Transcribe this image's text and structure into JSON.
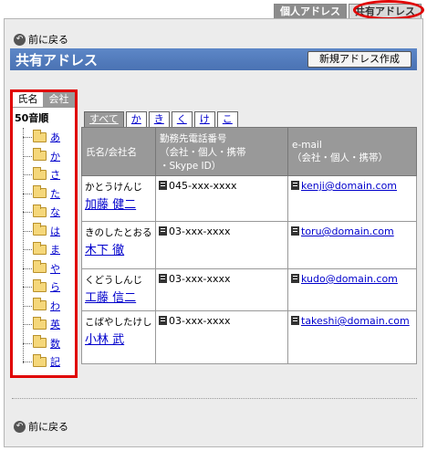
{
  "top_tabs": [
    {
      "label": "個人アドレス"
    },
    {
      "label": "共有アドレス"
    }
  ],
  "back_label": "前に戻る",
  "back_label_bottom": "前に戻る",
  "title": "共有アドレス",
  "new_button": "新規アドレス作成",
  "index": {
    "tabs": [
      {
        "label": "氏名"
      },
      {
        "label": "会社"
      }
    ],
    "heading": "50音順",
    "items": [
      {
        "label": "あ"
      },
      {
        "label": "か"
      },
      {
        "label": "さ"
      },
      {
        "label": "た"
      },
      {
        "label": "な"
      },
      {
        "label": "は"
      },
      {
        "label": "ま"
      },
      {
        "label": "や"
      },
      {
        "label": "ら"
      },
      {
        "label": "わ"
      },
      {
        "label": "英"
      },
      {
        "label": "数"
      },
      {
        "label": "記"
      }
    ]
  },
  "kana_tabs": [
    {
      "label": "すべて"
    },
    {
      "label": "か"
    },
    {
      "label": "き"
    },
    {
      "label": "く"
    },
    {
      "label": "け"
    },
    {
      "label": "こ"
    }
  ],
  "table": {
    "headers": {
      "name": "氏名/会社名",
      "phone": "勤務先電話番号\n（会社・個人・携帯\n・Skype ID）",
      "email": "e-mail\n（会社・個人・携帯）"
    },
    "rows": [
      {
        "kana": "かとうけんじ",
        "name": "加藤 健二",
        "phone": "045-xxx-xxxx",
        "email": "kenji@domain.com"
      },
      {
        "kana": "きのしたとおる",
        "name": "木下 徹",
        "phone": "03-xxx-xxxx",
        "email": "toru@domain.com"
      },
      {
        "kana": "くどうしんじ",
        "name": "工藤 信二",
        "phone": "03-xxx-xxxx",
        "email": "kudo@domain.com"
      },
      {
        "kana": "こばやしたけし",
        "name": "小林 武",
        "phone": "03-xxx-xxxx",
        "email": "takeshi@domain.com"
      }
    ]
  },
  "colors": {
    "title_bar": "#4f78b9",
    "highlight": "#e00000",
    "link": "#0000cc"
  }
}
